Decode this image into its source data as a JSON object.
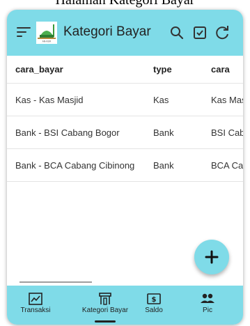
{
  "page": {
    "heading": "Halaman Kategori Bayar"
  },
  "app": {
    "title": "Kategori Bayar",
    "logo_caption": "AN-NUR",
    "actions": [
      "search-icon",
      "checkbox-icon",
      "refresh-icon"
    ]
  },
  "table": {
    "columns": [
      "cara_bayar",
      "type",
      "cara"
    ],
    "rows": [
      [
        "Kas - Kas Masjid",
        "Kas",
        "Kas Masjid"
      ],
      [
        "Bank - BSI Cabang Bogor",
        "Bank",
        "BSI Cabang Bogor"
      ],
      [
        "Bank - BCA Cabang Cibinong",
        "Bank",
        "BCA Cabang Cibinong"
      ]
    ]
  },
  "fab": {
    "icon": "plus-icon"
  },
  "bottom_nav": {
    "selected": "Kategori Bayar",
    "items": [
      {
        "label": "Transaksi",
        "icon": "chart-icon"
      },
      {
        "label": "Kategori Bayar",
        "icon": "category-icon"
      },
      {
        "label": "Saldo",
        "icon": "money-icon"
      },
      {
        "label": "Pic",
        "icon": "people-icon"
      }
    ]
  },
  "colors": {
    "primary": "#7fdbe8",
    "accent_text": "#222222",
    "logo_green": "#3a9a3a"
  }
}
